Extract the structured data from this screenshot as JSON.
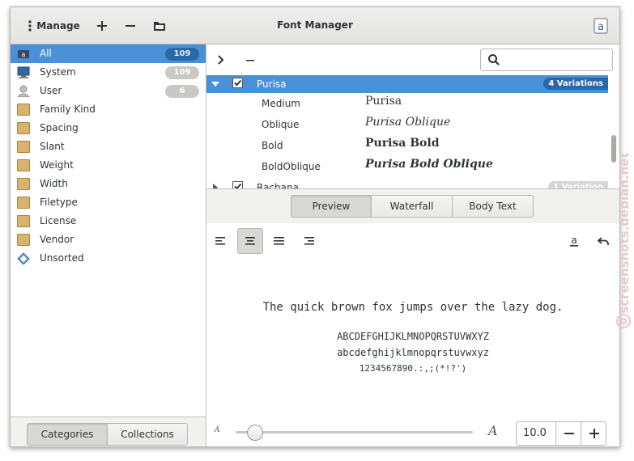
{
  "header": {
    "manage_label": "Manage",
    "add_icon": "plus-icon",
    "remove_icon": "minus-icon",
    "folder_icon": "folder-icon",
    "title": "Font Manager",
    "about_icon": "font-manager-app-icon"
  },
  "sidebar": {
    "categories": [
      {
        "label": "All",
        "count": "109",
        "icon": "fonts-icon"
      },
      {
        "label": "System",
        "count": "109",
        "icon": "computer-icon"
      },
      {
        "label": "User",
        "count": "6",
        "icon": "user-icon"
      },
      {
        "label": "Family Kind",
        "icon": "folder-icon"
      },
      {
        "label": "Spacing",
        "icon": "folder-icon"
      },
      {
        "label": "Slant",
        "icon": "folder-icon"
      },
      {
        "label": "Weight",
        "icon": "folder-icon"
      },
      {
        "label": "Width",
        "icon": "folder-icon"
      },
      {
        "label": "Filetype",
        "icon": "folder-icon"
      },
      {
        "label": "License",
        "icon": "folder-icon"
      },
      {
        "label": "Vendor",
        "icon": "folder-icon"
      },
      {
        "label": "Unsorted",
        "icon": "diamond-icon"
      }
    ],
    "tabs": {
      "categories": "Categories",
      "collections": "Collections"
    }
  },
  "fontlist": {
    "search_placeholder": "",
    "families": [
      {
        "name": "Purisa",
        "variations_label": "4 Variations"
      },
      {
        "name": "Rachana",
        "variations_label": "1 Variation"
      }
    ],
    "variations": [
      {
        "style": "Medium",
        "preview": "Purisa"
      },
      {
        "style": "Oblique",
        "preview": "Purisa Oblique"
      },
      {
        "style": "Bold",
        "preview": "Purisa Bold"
      },
      {
        "style": "BoldOblique",
        "preview": "Purisa Bold Oblique"
      }
    ]
  },
  "preview_tabs": {
    "preview": "Preview",
    "waterfall": "Waterfall",
    "body_text": "Body Text"
  },
  "preview": {
    "sentence": "The quick brown fox jumps over the lazy dog.",
    "uppercase": "ABCDEFGHIJKLMNOPQRSTUVWXYZ",
    "lowercase": "abcdefghijklmnopqrstuvwxyz",
    "digits": "1234567890.:,;(*!?')"
  },
  "size": {
    "value": "10.0",
    "small_a": "A",
    "large_a": "A",
    "slider_fraction": 0.05
  },
  "watermark": "screenshots.debian.net",
  "colors": {
    "accent": "#4a90d9",
    "badge_dark": "#2a69a8"
  }
}
